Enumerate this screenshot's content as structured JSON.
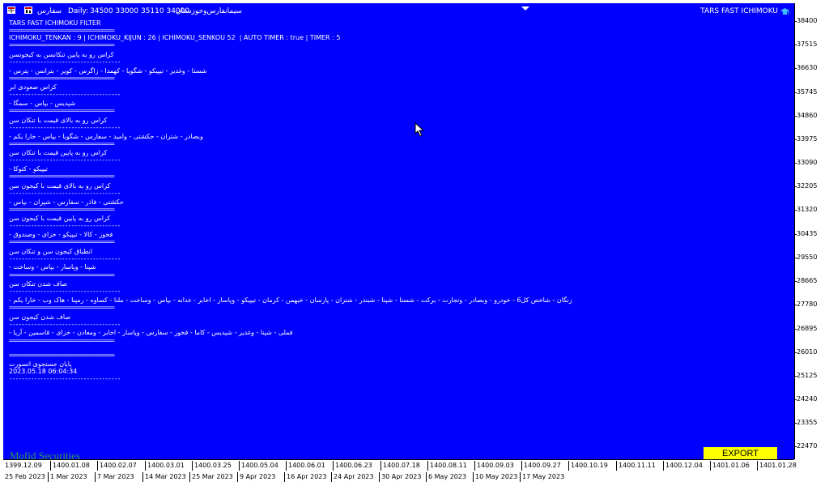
{
  "header": {
    "symbol": "سفارس",
    "daily_label": "Daily:",
    "ohlc": "34500 33000 35110 34000",
    "company": "سیمانفارس‌وخوزستان",
    "indicator_name": "TARS FAST ICHIMOKU",
    "icons": [
      "grid-table-icon",
      "bar-chart-icon",
      "graduation-cap-icon"
    ]
  },
  "report": {
    "title": "TARS FAST ICHIMOKU FILTER",
    "separator_long": "==================================",
    "separator_short": "------------------------------------",
    "params": "ICHIMOKU_TENKAN : 9 | ICHIMOKU_KIJUN : 26 | ICHIMOKU_SENKOU 52  | AUTO TIMER : true | TIMER : 5",
    "sections": [
      {
        "heading": "کراس رو به پایین تنکانسن به کیجونسن",
        "items": "شستا - وغدیر - تیپیکو - شگویا - کهمدا - زاگرس - کویر - بترانس - پترس -"
      },
      {
        "heading": "کراس صعودی ابر",
        "items": "شپدیس - بپاس - سمگا -"
      },
      {
        "heading": "کراس رو به بالای قیمت با تنکان سن",
        "items": "وبصادر - شتران - حکشتی - وامید - سفارس - شگویا - بپاس - خارا یکم -"
      },
      {
        "heading": "کراس رو به پایین قیمت با تنکان سن",
        "items": "تیپیکو - کتوکا -"
      },
      {
        "heading": "کراس رو به بالای قیمت با کیجون سن",
        "items": "حکشتی - فاذر - سفارس - شپران - بپاس -"
      },
      {
        "heading": "کراس رو به پایین قیمت با کیجون سن",
        "items": "فخوز - کالا - تیپیکو - خزای - وصندوق -"
      },
      {
        "heading": "انطباق کیجون سن و تنکان سن",
        "items": "شپنا - وپاسار - بپاس - وساخت -"
      },
      {
        "heading": "صاف شدن تنکان سن",
        "items": "زنگان - شاخص کل6 - خودرو - وبصادر - وتجارت - برکت - شستا - شپنا - شبندر - شتران - پارسان - خبهمن - کرمان - تیپیکو - وپاسار - اخابر - غدانه - بپاس - وساخت - ملنا - کساوه - رمپنا - هاک وب - خارا یکم -"
      },
      {
        "heading": "صاف شدن کیجون سن",
        "items": "فملی - شپنا - وغدیر - شپدیس - کاما - فخوز - سفارس - وپاسار - اخابر - ومعادن - خزای - قاسمین - آریا -"
      }
    ],
    "end_title": "پایان جستجوی اتسورت",
    "end_timestamp": "2023.05.18 06:04:34"
  },
  "price_axis": [
    "38400",
    "37515",
    "36630",
    "35745",
    "34860",
    "33975",
    "33090",
    "32205",
    "31320",
    "30435",
    "29550",
    "28665",
    "27780",
    "26895",
    "26010",
    "25125",
    "24240",
    "23355",
    "22470"
  ],
  "time_axis": {
    "row1": [
      "1399.12.09",
      "1400.01.08",
      "1400.02.07",
      "1400.03.01",
      "1400.03.25",
      "1400.05.04",
      "1400.06.01",
      "1400.06.23",
      "1400.07.18",
      "1400.08.11",
      "1400.09.03",
      "1400.09.27",
      "1400.10.19",
      "1400.11.11",
      "1400.12.04",
      "1401.01.06",
      "1401.01.28"
    ],
    "row2": [
      "25 Feb 2023",
      "1 Mar 2023",
      "7 Mar 2023",
      "14 Mar 2023",
      "25 Mar 2023",
      "9 Apr 2023",
      "16 Apr 2023",
      "24 Apr 2023",
      "30 Apr 2023",
      "6 May 2023",
      "10 May 2023",
      "17 May 2023"
    ]
  },
  "watermark": "Mofid Securities",
  "export_button": "EXPORT",
  "colors": {
    "chart_bg": "#0000ff",
    "text": "#ffffff",
    "export_bg": "#ffff00",
    "watermark": "#2e9c4a"
  }
}
